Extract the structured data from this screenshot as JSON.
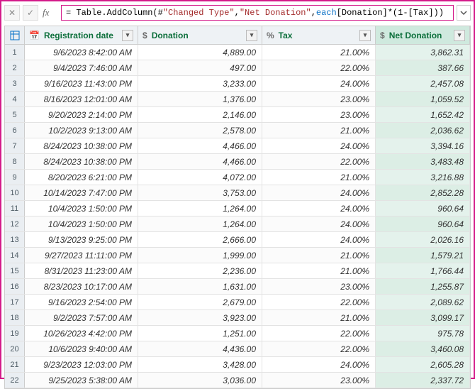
{
  "formula": {
    "fx_label": "fx",
    "prefix": "= Table.AddColumn(#",
    "str1": "\"Changed Type\"",
    "mid1": ", ",
    "str2": "\"Net Donation\"",
    "mid2": ", ",
    "each": "each",
    "suffix": " [Donation]*(1-[Tax]))"
  },
  "columns": {
    "reg": "Registration date",
    "don": "Donation",
    "tax": "Tax",
    "net": "Net Donation"
  },
  "icons": {
    "date": "📅",
    "dollar": "$",
    "percent": "%"
  },
  "rows": [
    {
      "n": "1",
      "reg": "9/6/2023 8:42:00 AM",
      "don": "4,889.00",
      "tax": "21.00%",
      "net": "3,862.31"
    },
    {
      "n": "2",
      "reg": "9/4/2023 7:46:00 AM",
      "don": "497.00",
      "tax": "22.00%",
      "net": "387.66"
    },
    {
      "n": "3",
      "reg": "9/16/2023 11:43:00 PM",
      "don": "3,233.00",
      "tax": "24.00%",
      "net": "2,457.08"
    },
    {
      "n": "4",
      "reg": "8/16/2023 12:01:00 AM",
      "don": "1,376.00",
      "tax": "23.00%",
      "net": "1,059.52"
    },
    {
      "n": "5",
      "reg": "9/20/2023 2:14:00 PM",
      "don": "2,146.00",
      "tax": "23.00%",
      "net": "1,652.42"
    },
    {
      "n": "6",
      "reg": "10/2/2023 9:13:00 AM",
      "don": "2,578.00",
      "tax": "21.00%",
      "net": "2,036.62"
    },
    {
      "n": "7",
      "reg": "8/24/2023 10:38:00 PM",
      "don": "4,466.00",
      "tax": "24.00%",
      "net": "3,394.16"
    },
    {
      "n": "8",
      "reg": "8/24/2023 10:38:00 PM",
      "don": "4,466.00",
      "tax": "22.00%",
      "net": "3,483.48"
    },
    {
      "n": "9",
      "reg": "8/20/2023 6:21:00 PM",
      "don": "4,072.00",
      "tax": "21.00%",
      "net": "3,216.88"
    },
    {
      "n": "10",
      "reg": "10/14/2023 7:47:00 PM",
      "don": "3,753.00",
      "tax": "24.00%",
      "net": "2,852.28"
    },
    {
      "n": "11",
      "reg": "10/4/2023 1:50:00 PM",
      "don": "1,264.00",
      "tax": "24.00%",
      "net": "960.64"
    },
    {
      "n": "12",
      "reg": "10/4/2023 1:50:00 PM",
      "don": "1,264.00",
      "tax": "24.00%",
      "net": "960.64"
    },
    {
      "n": "13",
      "reg": "9/13/2023 9:25:00 PM",
      "don": "2,666.00",
      "tax": "24.00%",
      "net": "2,026.16"
    },
    {
      "n": "14",
      "reg": "9/27/2023 11:11:00 PM",
      "don": "1,999.00",
      "tax": "21.00%",
      "net": "1,579.21"
    },
    {
      "n": "15",
      "reg": "8/31/2023 11:23:00 AM",
      "don": "2,236.00",
      "tax": "21.00%",
      "net": "1,766.44"
    },
    {
      "n": "16",
      "reg": "8/23/2023 10:17:00 AM",
      "don": "1,631.00",
      "tax": "23.00%",
      "net": "1,255.87"
    },
    {
      "n": "17",
      "reg": "9/16/2023 2:54:00 PM",
      "don": "2,679.00",
      "tax": "22.00%",
      "net": "2,089.62"
    },
    {
      "n": "18",
      "reg": "9/2/2023 7:57:00 AM",
      "don": "3,923.00",
      "tax": "21.00%",
      "net": "3,099.17"
    },
    {
      "n": "19",
      "reg": "10/26/2023 4:42:00 PM",
      "don": "1,251.00",
      "tax": "22.00%",
      "net": "975.78"
    },
    {
      "n": "20",
      "reg": "10/6/2023 9:40:00 AM",
      "don": "4,436.00",
      "tax": "22.00%",
      "net": "3,460.08"
    },
    {
      "n": "21",
      "reg": "9/23/2023 12:03:00 PM",
      "don": "3,428.00",
      "tax": "24.00%",
      "net": "2,605.28"
    },
    {
      "n": "22",
      "reg": "9/25/2023 5:38:00 AM",
      "don": "3,036.00",
      "tax": "23.00%",
      "net": "2,337.72"
    }
  ]
}
